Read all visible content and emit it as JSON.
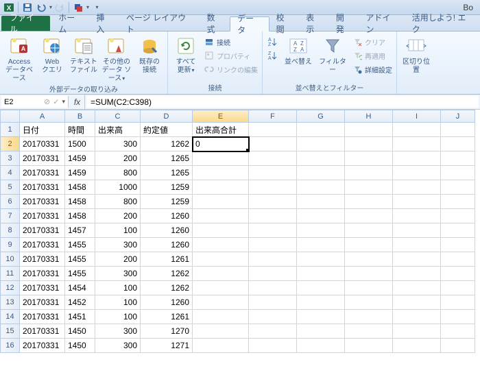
{
  "title": "Bo",
  "qat": {
    "excel": "X",
    "save": "💾",
    "undo": "↶",
    "redo": "↷"
  },
  "tabs": {
    "file": "ファイル",
    "items": [
      "ホーム",
      "挿入",
      "ページ レイアウト",
      "数式",
      "データ",
      "校閲",
      "表示",
      "開発",
      "アドイン",
      "活用しよう! エク"
    ],
    "activeIndex": 4
  },
  "ribbon": {
    "group_extdata": {
      "label": "外部データの取り込み",
      "access": "Access\nデータベース",
      "web": "Web\nクエリ",
      "text": "テキスト\nファイル",
      "other": "その他の\nデータ ソース",
      "existing": "既存の\n接続"
    },
    "group_conn": {
      "label": "接続",
      "refresh": "すべて\n更新",
      "conn": "接続",
      "props": "プロパティ",
      "editlinks": "リンクの編集"
    },
    "group_sort": {
      "label": "並べ替えとフィルター",
      "sort": "並べ替え",
      "filter": "フィルター",
      "clear": "クリア",
      "reapply": "再適用",
      "advanced": "詳細設定"
    },
    "group_tools": {
      "t2c": "区切り位置"
    }
  },
  "namebox": "E2",
  "formula": "=SUM(C2:C398)",
  "columns": [
    "A",
    "B",
    "C",
    "D",
    "E",
    "F",
    "G",
    "H",
    "I",
    "J"
  ],
  "headers": {
    "A": "日付",
    "B": "時間",
    "C": "出来高",
    "D": "約定値",
    "E": "出来高合計"
  },
  "activeCell": {
    "row": 2,
    "col": "E",
    "value": "0"
  },
  "rows": [
    {
      "n": 2,
      "A": "20170331",
      "B": "1500",
      "C": "300",
      "D": "1262"
    },
    {
      "n": 3,
      "A": "20170331",
      "B": "1459",
      "C": "200",
      "D": "1265"
    },
    {
      "n": 4,
      "A": "20170331",
      "B": "1459",
      "C": "800",
      "D": "1265"
    },
    {
      "n": 5,
      "A": "20170331",
      "B": "1458",
      "C": "1000",
      "D": "1259"
    },
    {
      "n": 6,
      "A": "20170331",
      "B": "1458",
      "C": "800",
      "D": "1259"
    },
    {
      "n": 7,
      "A": "20170331",
      "B": "1458",
      "C": "200",
      "D": "1260"
    },
    {
      "n": 8,
      "A": "20170331",
      "B": "1457",
      "C": "100",
      "D": "1260"
    },
    {
      "n": 9,
      "A": "20170331",
      "B": "1455",
      "C": "300",
      "D": "1260"
    },
    {
      "n": 10,
      "A": "20170331",
      "B": "1455",
      "C": "200",
      "D": "1261"
    },
    {
      "n": 11,
      "A": "20170331",
      "B": "1455",
      "C": "300",
      "D": "1262"
    },
    {
      "n": 12,
      "A": "20170331",
      "B": "1454",
      "C": "100",
      "D": "1262"
    },
    {
      "n": 13,
      "A": "20170331",
      "B": "1452",
      "C": "100",
      "D": "1260"
    },
    {
      "n": 14,
      "A": "20170331",
      "B": "1451",
      "C": "100",
      "D": "1261"
    },
    {
      "n": 15,
      "A": "20170331",
      "B": "1450",
      "C": "300",
      "D": "1270"
    },
    {
      "n": 16,
      "A": "20170331",
      "B": "1450",
      "C": "300",
      "D": "1271"
    }
  ],
  "chart_data": {
    "type": "table",
    "title": "",
    "columns": [
      "日付",
      "時間",
      "出来高",
      "約定値",
      "出来高合計"
    ],
    "rows": [
      [
        "20170331",
        1500,
        300,
        1262,
        0
      ],
      [
        "20170331",
        1459,
        200,
        1265,
        null
      ],
      [
        "20170331",
        1459,
        800,
        1265,
        null
      ],
      [
        "20170331",
        1458,
        1000,
        1259,
        null
      ],
      [
        "20170331",
        1458,
        800,
        1259,
        null
      ],
      [
        "20170331",
        1458,
        200,
        1260,
        null
      ],
      [
        "20170331",
        1457,
        100,
        1260,
        null
      ],
      [
        "20170331",
        1455,
        300,
        1260,
        null
      ],
      [
        "20170331",
        1455,
        200,
        1261,
        null
      ],
      [
        "20170331",
        1455,
        300,
        1262,
        null
      ],
      [
        "20170331",
        1454,
        100,
        1262,
        null
      ],
      [
        "20170331",
        1452,
        100,
        1260,
        null
      ],
      [
        "20170331",
        1451,
        100,
        1261,
        null
      ],
      [
        "20170331",
        1450,
        300,
        1270,
        null
      ],
      [
        "20170331",
        1450,
        300,
        1271,
        null
      ]
    ]
  }
}
